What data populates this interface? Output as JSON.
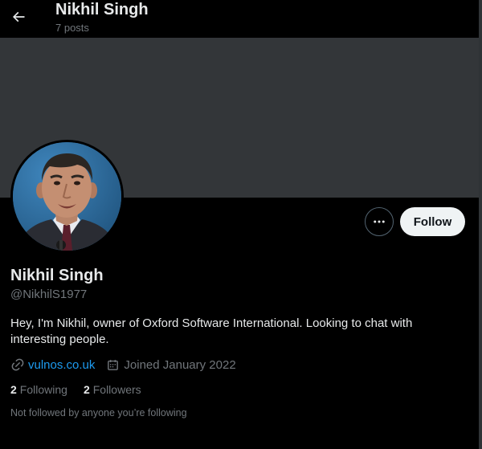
{
  "header": {
    "title": "Nikhil Singh",
    "post_count": "7 posts",
    "back_icon": "arrow-left-icon"
  },
  "profile": {
    "display_name": "Nikhil Singh",
    "handle": "@NikhilS1977",
    "bio": "Hey, I'm Nikhil, owner of Oxford Software International. Looking to chat with interesting people.",
    "website": "vulnos.co.uk",
    "joined": "Joined January 2022",
    "following_count": "2",
    "following_label": "Following",
    "followers_count": "2",
    "followers_label": "Followers",
    "not_followed_text": "Not followed by anyone you’re following"
  },
  "actions": {
    "follow_label": "Follow",
    "more_icon": "more-horizontal-icon"
  },
  "colors": {
    "background": "#000000",
    "banner": "#333639",
    "link": "#1d9bf0",
    "primary_text": "#e7e9ea",
    "secondary_text": "#71767b",
    "follow_button_bg": "#eff3f4"
  }
}
